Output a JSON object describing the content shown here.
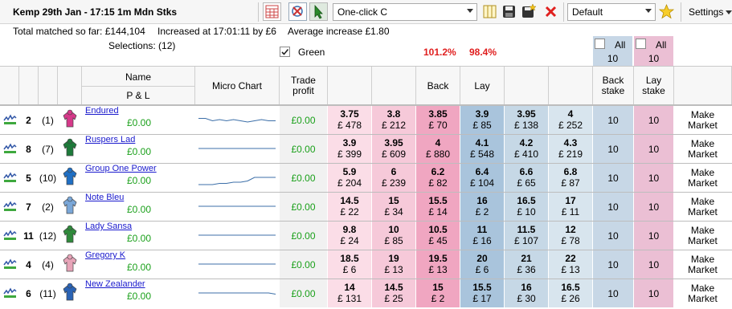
{
  "title": "Kemp 29th Jan - 17:15 1m Mdn Stks",
  "toolbar": {
    "mode_value": "One-click C",
    "profile_value": "Default",
    "settings_label": "Settings"
  },
  "info": {
    "total_matched": "Total matched so far: £144,104",
    "increased": "Increased at 17:01:11 by £6",
    "avg_increase": "Average increase £1.80",
    "selections": "Selections: (12)",
    "green_label": "Green",
    "back_pct": "101.2%",
    "lay_pct": "98.4%",
    "all_label": "All",
    "all_back_value": "10",
    "all_lay_value": "10"
  },
  "headers": {
    "name": "Name",
    "pl": "P & L",
    "micro_chart": "Micro Chart",
    "trade_profit": "Trade profit",
    "back": "Back",
    "lay": "Lay",
    "back_stake": "Back stake",
    "lay_stake": "Lay stake"
  },
  "runners": [
    {
      "num": "2",
      "draw": "(1)",
      "name": "Endured",
      "pl": "£0.00",
      "trade": "£0.00",
      "silks": "#d6398a",
      "back": [
        [
          "3.75",
          "£ 478"
        ],
        [
          "3.8",
          "£ 212"
        ],
        [
          "3.85",
          "£ 70"
        ]
      ],
      "lay": [
        [
          "3.9",
          "£ 85"
        ],
        [
          "3.95",
          "£ 138"
        ],
        [
          "4",
          "£ 252"
        ]
      ],
      "back_stake": "10",
      "lay_stake": "10",
      "mm": "Make Market",
      "spark": [
        0.45,
        0.45,
        0.55,
        0.5,
        0.55,
        0.5,
        0.55,
        0.6,
        0.55,
        0.5,
        0.55,
        0.55
      ]
    },
    {
      "num": "8",
      "draw": "(7)",
      "name": "Ruspers Lad",
      "pl": "£0.00",
      "trade": "£0.00",
      "silks": "#1d7a3a",
      "back": [
        [
          "3.9",
          "£ 399"
        ],
        [
          "3.95",
          "£ 609"
        ],
        [
          "4",
          "£ 880"
        ]
      ],
      "lay": [
        [
          "4.1",
          "£ 548"
        ],
        [
          "4.2",
          "£ 410"
        ],
        [
          "4.3",
          "£ 219"
        ]
      ],
      "back_stake": "10",
      "lay_stake": "10",
      "mm": "Make Market",
      "spark": [
        0.5,
        0.5,
        0.5,
        0.5,
        0.5,
        0.5,
        0.5,
        0.5,
        0.5,
        0.5,
        0.5,
        0.5
      ]
    },
    {
      "num": "5",
      "draw": "(10)",
      "name": "Group One Power",
      "pl": "£0.00",
      "trade": "£0.00",
      "silks": "#1f6fc4",
      "back": [
        [
          "5.9",
          "£ 204"
        ],
        [
          "6",
          "£ 239"
        ],
        [
          "6.2",
          "£ 82"
        ]
      ],
      "lay": [
        [
          "6.4",
          "£ 104"
        ],
        [
          "6.6",
          "£ 65"
        ],
        [
          "6.8",
          "£ 87"
        ]
      ],
      "back_stake": "10",
      "lay_stake": "10",
      "mm": "Make Market",
      "spark": [
        0.8,
        0.8,
        0.8,
        0.75,
        0.75,
        0.7,
        0.7,
        0.65,
        0.5,
        0.5,
        0.5,
        0.5
      ]
    },
    {
      "num": "7",
      "draw": "(2)",
      "name": "Note Bleu",
      "pl": "£0.00",
      "trade": "£0.00",
      "silks": "#7aa7d8",
      "back": [
        [
          "14.5",
          "£ 22"
        ],
        [
          "15",
          "£ 34"
        ],
        [
          "15.5",
          "£ 14"
        ]
      ],
      "lay": [
        [
          "16",
          "£ 2"
        ],
        [
          "16.5",
          "£ 10"
        ],
        [
          "17",
          "£ 11"
        ]
      ],
      "back_stake": "10",
      "lay_stake": "10",
      "mm": "Make Market",
      "spark": [
        0.5,
        0.5,
        0.5,
        0.5,
        0.5,
        0.5,
        0.5,
        0.5,
        0.5,
        0.5,
        0.5,
        0.5
      ]
    },
    {
      "num": "11",
      "draw": "(12)",
      "name": "Lady Sansa",
      "pl": "£0.00",
      "trade": "£0.00",
      "silks": "#2f8a3b",
      "back": [
        [
          "9.8",
          "£ 24"
        ],
        [
          "10",
          "£ 85"
        ],
        [
          "10.5",
          "£ 45"
        ]
      ],
      "lay": [
        [
          "11",
          "£ 16"
        ],
        [
          "11.5",
          "£ 107"
        ],
        [
          "12",
          "£ 78"
        ]
      ],
      "back_stake": "10",
      "lay_stake": "10",
      "mm": "Make Market",
      "spark": [
        0.5,
        0.5,
        0.5,
        0.5,
        0.5,
        0.5,
        0.5,
        0.5,
        0.5,
        0.5,
        0.5,
        0.5
      ]
    },
    {
      "num": "4",
      "draw": "(4)",
      "name": "Gregory K",
      "pl": "£0.00",
      "trade": "£0.00",
      "silks": "#e7a4b8",
      "back": [
        [
          "18.5",
          "£ 6"
        ],
        [
          "19",
          "£ 13"
        ],
        [
          "19.5",
          "£ 13"
        ]
      ],
      "lay": [
        [
          "20",
          "£ 6"
        ],
        [
          "21",
          "£ 36"
        ],
        [
          "22",
          "£ 13"
        ]
      ],
      "back_stake": "10",
      "lay_stake": "10",
      "mm": "Make Market",
      "spark": [
        0.5,
        0.5,
        0.5,
        0.5,
        0.5,
        0.5,
        0.5,
        0.5,
        0.5,
        0.5,
        0.5,
        0.5
      ]
    },
    {
      "num": "6",
      "draw": "(11)",
      "name": "New Zealander",
      "pl": "£0.00",
      "trade": "£0.00",
      "silks": "#2a63b5",
      "back": [
        [
          "14",
          "£ 131"
        ],
        [
          "14.5",
          "£ 25"
        ],
        [
          "15",
          "£ 2"
        ]
      ],
      "lay": [
        [
          "15.5",
          "£ 17"
        ],
        [
          "16",
          "£ 30"
        ],
        [
          "16.5",
          "£ 26"
        ]
      ],
      "back_stake": "10",
      "lay_stake": "10",
      "mm": "Make Market",
      "spark": [
        0.5,
        0.5,
        0.5,
        0.5,
        0.5,
        0.5,
        0.5,
        0.5,
        0.5,
        0.5,
        0.5,
        0.55
      ]
    }
  ]
}
